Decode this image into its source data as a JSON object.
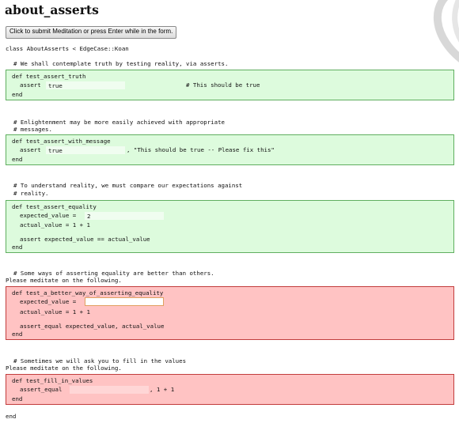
{
  "page": {
    "title": "about_asserts",
    "submit_label": "Click to submit Meditation or press Enter while in the form.",
    "class_decl": "class AboutAsserts < EdgeCase::Koan",
    "end_label": "end"
  },
  "koans": [
    {
      "status": "pass",
      "comments": [
        "# We shall contemplate truth by testing reality, via asserts."
      ],
      "def": "def test_assert_truth",
      "assert_prefix": "assert",
      "input_value": "true",
      "trailing": "# This should be true",
      "end": "end"
    },
    {
      "status": "pass",
      "comments": [
        "# Enlightenment may be more easily achieved with appropriate",
        "# messages."
      ],
      "def": "def test_assert_with_message",
      "assert_prefix": "assert",
      "input_value": "true",
      "trailing": ", \"This should be true -- Please fix this\"",
      "end": "end"
    },
    {
      "status": "pass",
      "comments": [
        "# To understand reality, we must compare our expectations against",
        "# reality."
      ],
      "def": "def test_assert_equality",
      "expected_prefix": "expected_value =",
      "input_value": "2",
      "actual_line": "actual_value = 1 + 1",
      "assert_line": "assert expected_value == actual_value",
      "end": "end"
    },
    {
      "status": "fail",
      "comments": [
        "# Some ways of asserting equality are better than others."
      ],
      "meditate": "Please meditate on the following.",
      "def": "def test_a_better_way_of_asserting_equality",
      "expected_prefix": "expected_value =",
      "input_value": "",
      "actual_line": "actual_value = 1 + 1",
      "assert_line": "assert_equal expected_value, actual_value",
      "end": "end"
    },
    {
      "status": "fail",
      "comments": [
        "# Sometimes we will ask you to fill in the values"
      ],
      "meditate": "Please meditate on the following.",
      "def": "def test_fill_in_values",
      "assert_prefix": "assert_equal",
      "input_value": "",
      "trailing": ", 1 + 1",
      "end": "end"
    }
  ],
  "colors": {
    "pass_bg": "#ddfbdd",
    "pass_border": "#5fae5f",
    "fail_bg": "#ffc3c3",
    "fail_border": "#c23c3c"
  }
}
